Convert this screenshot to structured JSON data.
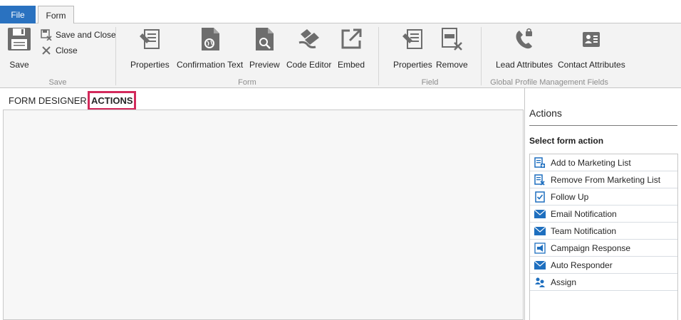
{
  "tabs": {
    "file": "File",
    "form": "Form"
  },
  "ribbon": {
    "save_group": {
      "label": "Save",
      "save": "Save",
      "save_and_close": "Save and Close",
      "close": "Close"
    },
    "form_group": {
      "label": "Form",
      "properties": "Properties",
      "confirmation_text": "Confirmation Text",
      "preview": "Preview",
      "code_editor": "Code Editor",
      "embed": "Embed"
    },
    "field_group": {
      "label": "Field",
      "properties": "Properties",
      "remove": "Remove"
    },
    "profile_group": {
      "label": "Global Profile Management Fields",
      "lead_attributes": "Lead Attributes",
      "contact_attributes": "Contact Attributes"
    }
  },
  "designer_tabs": {
    "form_designer": "FORM DESIGNER",
    "actions": "ACTIONS"
  },
  "panel": {
    "title": "Actions",
    "subtitle": "Select form action",
    "items": [
      {
        "label": "Add to Marketing List",
        "icon": "add-list-icon"
      },
      {
        "label": "Remove From Marketing List",
        "icon": "remove-list-icon"
      },
      {
        "label": "Follow Up",
        "icon": "checklist-icon"
      },
      {
        "label": "Email Notification",
        "icon": "envelope-icon"
      },
      {
        "label": "Team Notification",
        "icon": "envelope-icon"
      },
      {
        "label": "Campaign Response",
        "icon": "megaphone-icon"
      },
      {
        "label": "Auto Responder",
        "icon": "envelope-icon"
      },
      {
        "label": "Assign",
        "icon": "users-icon"
      }
    ]
  },
  "colors": {
    "accent": "#2a72c0",
    "highlight": "#d22a5b",
    "icon_gray": "#6d6d6d",
    "icon_blue": "#1e6fbf"
  }
}
